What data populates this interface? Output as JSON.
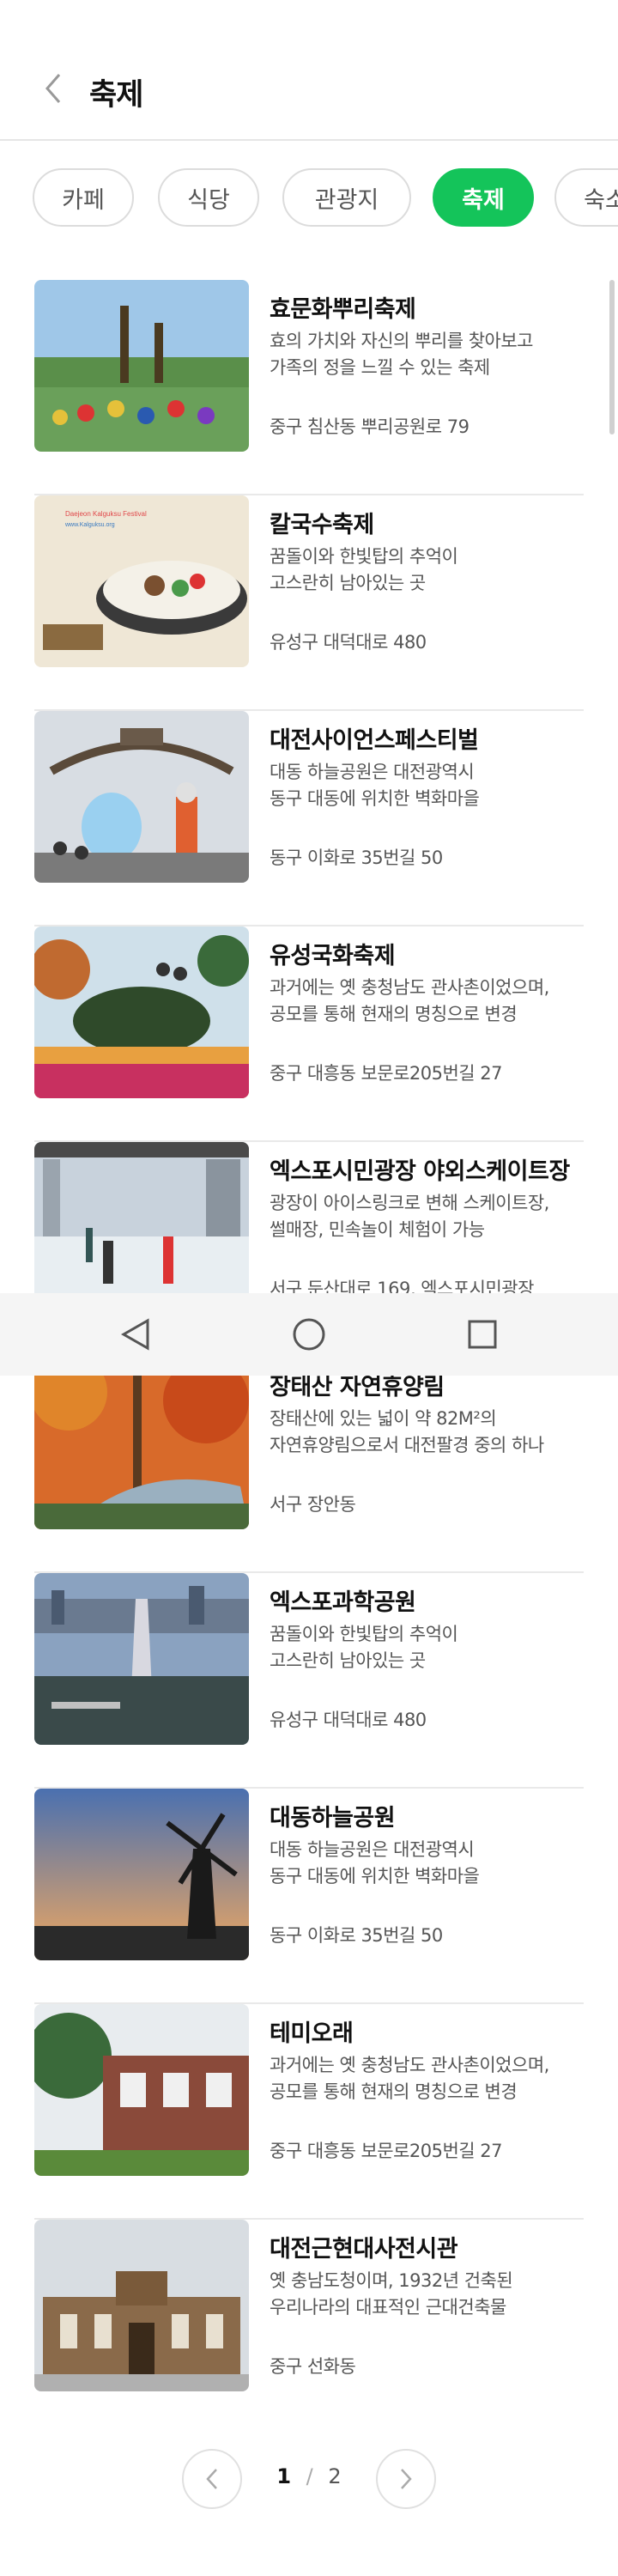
{
  "header": {
    "title": "축제"
  },
  "tabs": [
    {
      "label": "카페",
      "active": false
    },
    {
      "label": "식당",
      "active": false
    },
    {
      "label": "관광지",
      "active": false
    },
    {
      "label": "축제",
      "active": true
    },
    {
      "label": "숙소",
      "active": false
    }
  ],
  "items": [
    {
      "title": "효문화뿌리축제",
      "desc1": "효의 가치와 자신의 뿌리를 찾아보고",
      "desc2": "가족의 정을 느낄 수 있는 축제",
      "addr": "중구 침산동 뿌리공원로 79"
    },
    {
      "title": "칼국수축제",
      "desc1": "꿈돌이와 한빛탑의 추억이",
      "desc2": "고스란히 남아있는 곳",
      "addr": "유성구 대덕대로 480",
      "thumb_text1": "Daejeon Kalguksu Festival",
      "thumb_text2": "www.Kalguksu.org"
    },
    {
      "title": "대전사이언스페스티벌",
      "desc1": "대동 하늘공원은 대전광역시",
      "desc2": "동구 대동에 위치한 벽화마을",
      "addr": "동구 이화로 35번길 50"
    },
    {
      "title": "유성국화축제",
      "desc1": "과거에는 옛 충청남도 관사촌이었으며,",
      "desc2": "공모를 통해 현재의 명칭으로 변경",
      "addr": "중구 대흥동 보문로205번길 27"
    },
    {
      "title": "엑스포시민광장 야외스케이트장",
      "desc1": "광장이 아이스링크로 변해 스케이트장,",
      "desc2": "썰매장, 민속놀이 체험이 가능",
      "addr": "서구 둔산대로 169, 엑스포시민광장"
    },
    {
      "title": "장태산 자연휴양림",
      "desc1": "장태산에 있는 넓이 약 82M²의",
      "desc2": "자연휴양림으로서 대전팔경 중의 하나",
      "addr": "서구 장안동"
    },
    {
      "title": "엑스포과학공원",
      "desc1": "꿈돌이와 한빛탑의 추억이",
      "desc2": "고스란히 남아있는 곳",
      "addr": "유성구 대덕대로 480"
    },
    {
      "title": "대동하늘공원",
      "desc1": "대동 하늘공원은 대전광역시",
      "desc2": "동구 대동에 위치한 벽화마을",
      "addr": "동구 이화로 35번길 50"
    },
    {
      "title": "테미오래",
      "desc1": "과거에는 옛 충청남도 관사촌이었으며,",
      "desc2": "공모를 통해 현재의 명칭으로 변경",
      "addr": "중구 대흥동 보문로205번길 27"
    },
    {
      "title": "대전근현대사전시관",
      "desc1": "옛 충남도청이며, 1932년 건축된",
      "desc2": "우리나라의 대표적인 근대건축물",
      "addr": "중구 선화동"
    }
  ],
  "pager": {
    "current": "1",
    "separator": "/",
    "total": "2"
  },
  "colors": {
    "accent": "#14c45a",
    "text": "#111111",
    "muted": "#555555",
    "divider": "#e9e9e9"
  },
  "icons": {
    "back": "chevron-left-icon",
    "prev": "chevron-left-icon",
    "next": "chevron-right-icon",
    "nav_back": "triangle-back-icon",
    "nav_home": "circle-home-icon",
    "nav_recent": "square-recent-icon"
  }
}
